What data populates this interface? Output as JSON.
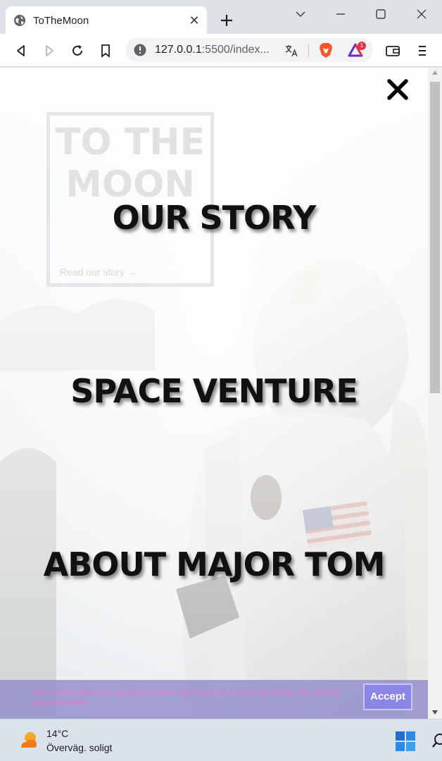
{
  "browser": {
    "tab": {
      "title": "ToTheMoon",
      "favicon": "globe-icon"
    },
    "new_tab_icon": "plus-icon",
    "address": {
      "host": "127.0.0.1",
      "rest": ":5500/index..."
    },
    "rewards_badge": "1"
  },
  "page": {
    "hero": {
      "title": "TO THE MOON",
      "link": "Read our story →"
    },
    "menu": {
      "items": [
        {
          "label": "OUR STORY"
        },
        {
          "label": "SPACE VENTURE"
        },
        {
          "label": "ABOUT MAJOR TOM"
        }
      ]
    },
    "cookie": {
      "text": "I don't know where I'm going from here, but I promise it won't be boring. You should accept cookies.",
      "accept_label": "Accept"
    }
  },
  "taskbar": {
    "weather": {
      "temp": "14°C",
      "desc": "Överväg. soligt"
    }
  },
  "colors": {
    "menu_text": "#111111",
    "cookie_bar": "#918ccd",
    "cookie_text": "#d87fd0",
    "accept_button": "#8a86e8",
    "brave_lion": "#fb542b"
  }
}
